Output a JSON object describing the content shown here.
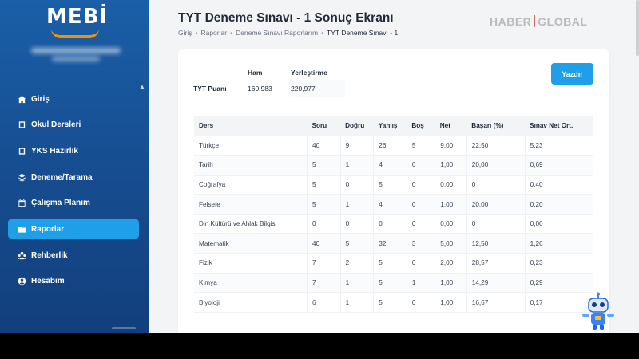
{
  "app": {
    "logo": "MEBİ"
  },
  "sidebar": {
    "items": [
      {
        "label": "Giriş",
        "icon": "home-icon",
        "active": false
      },
      {
        "label": "Okul Dersleri",
        "icon": "book-icon",
        "active": false
      },
      {
        "label": "YKS Hazırlık",
        "icon": "book-icon",
        "active": false
      },
      {
        "label": "Deneme/Tarama",
        "icon": "layers-icon",
        "active": false
      },
      {
        "label": "Çalışma Planım",
        "icon": "calendar-icon",
        "active": false
      },
      {
        "label": "Raporlar",
        "icon": "folder-icon",
        "active": true
      },
      {
        "label": "Rehberlik",
        "icon": "users-icon",
        "active": false
      },
      {
        "label": "Hesabım",
        "icon": "user-icon",
        "active": false
      }
    ]
  },
  "header": {
    "title": "TYT Deneme Sınavı - 1 Sonuç Ekranı",
    "breadcrumb": [
      "Giriş",
      "Raporlar",
      "Deneme Sınavı Raporlarım",
      "TYT Deneme Sınavı - 1"
    ],
    "watermark_left": "HABER",
    "watermark_right": "GLOBAL"
  },
  "score": {
    "col_ham": "Ham",
    "col_yerlestirme": "Yerleştirme",
    "row_label": "TYT Puanı",
    "ham": "160,983",
    "yerlestirme": "220,977"
  },
  "print_label": "Yazdır",
  "results": {
    "headers": [
      "Ders",
      "Soru",
      "Doğru",
      "Yanlış",
      "Boş",
      "Net",
      "Başarı (%)",
      "Sınav Net Ort."
    ],
    "rows": [
      [
        "Türkçe",
        "40",
        "9",
        "26",
        "5",
        "9,00",
        "22,50",
        "5,23"
      ],
      [
        "Tarih",
        "5",
        "1",
        "4",
        "0",
        "1,00",
        "20,00",
        "0,69"
      ],
      [
        "Coğrafya",
        "5",
        "0",
        "5",
        "0",
        "0,00",
        "0",
        "0,40"
      ],
      [
        "Felsefe",
        "5",
        "1",
        "4",
        "0",
        "1,00",
        "20,00",
        "0,20"
      ],
      [
        "Din Kültürü ve Ahlak Bilgisi",
        "0",
        "0",
        "0",
        "0",
        "0,00",
        "0",
        "0,00"
      ],
      [
        "Matematik",
        "40",
        "5",
        "32",
        "3",
        "5,00",
        "12,50",
        "1,26"
      ],
      [
        "Fizik",
        "7",
        "2",
        "5",
        "0",
        "2,00",
        "28,57",
        "0,23"
      ],
      [
        "Kimya",
        "7",
        "1",
        "5",
        "1",
        "1,00",
        "14,29",
        "0,29"
      ],
      [
        "Biyoloji",
        "6",
        "1",
        "5",
        "0",
        "1,00",
        "16,67",
        "0,17"
      ]
    ]
  },
  "colors": {
    "sidebar": "#1a5fa8",
    "accent": "#1e9fe8",
    "logo_smile": "#f39200"
  }
}
